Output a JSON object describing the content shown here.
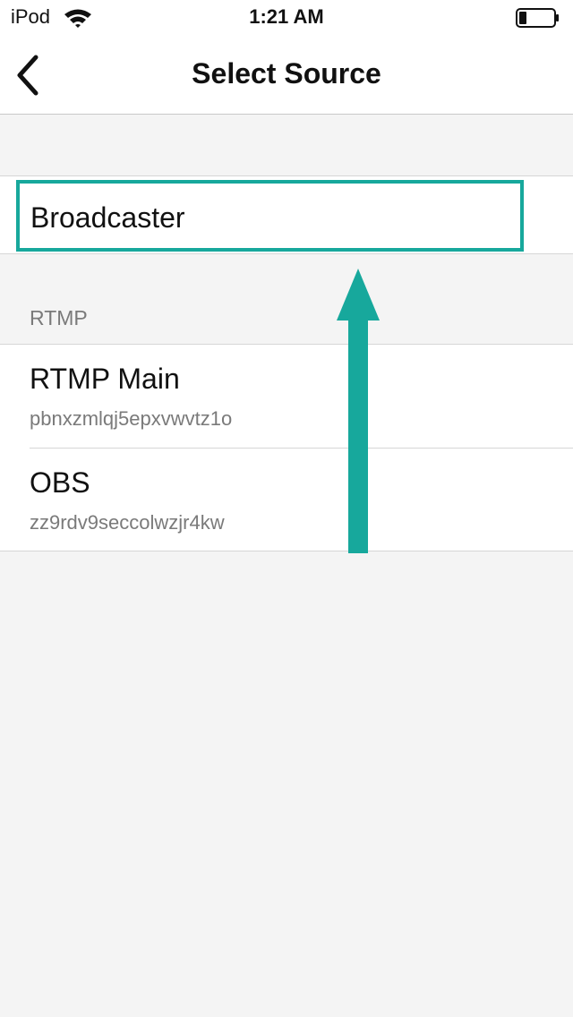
{
  "status_bar": {
    "carrier": "iPod",
    "time": "1:21 AM",
    "wifi_icon": "wifi-icon",
    "battery_icon": "battery-low-icon"
  },
  "nav": {
    "title": "Select Source",
    "back_icon": "chevron-left-icon"
  },
  "sources": {
    "primary": {
      "label": "Broadcaster"
    },
    "rtmp_section": {
      "header": "RTMP",
      "items": [
        {
          "name": "RTMP Main",
          "key": "pbnxzmlqj5epxvwvtz1o"
        },
        {
          "name": "OBS",
          "key": "zz9rdv9seccolwzjr4kw"
        }
      ]
    }
  },
  "colors": {
    "highlight": "#17a89c",
    "background": "#f4f4f4",
    "secondary_text": "#7a7a7a"
  }
}
